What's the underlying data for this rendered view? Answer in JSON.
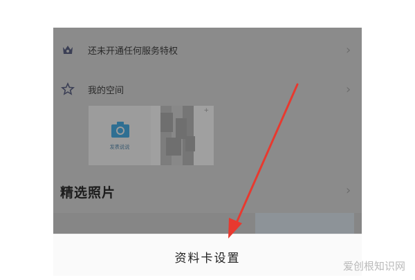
{
  "profile": {
    "rows": [
      {
        "label": "还未开通任何服务特权",
        "icon": "vip-crown-icon"
      },
      {
        "label": "我的空间",
        "icon": "star-icon"
      }
    ],
    "space": {
      "upload_label": "发表说说",
      "upload_icon": "camera-icon"
    },
    "section_title": "精选照片"
  },
  "bottom": {
    "settings_label": "资料卡设置"
  },
  "watermark": "爱创根知识网",
  "colors": {
    "annotation_arrow": "#e8392f",
    "camera_accent": "#2f6f92",
    "overlay": "#8b8b8b"
  }
}
